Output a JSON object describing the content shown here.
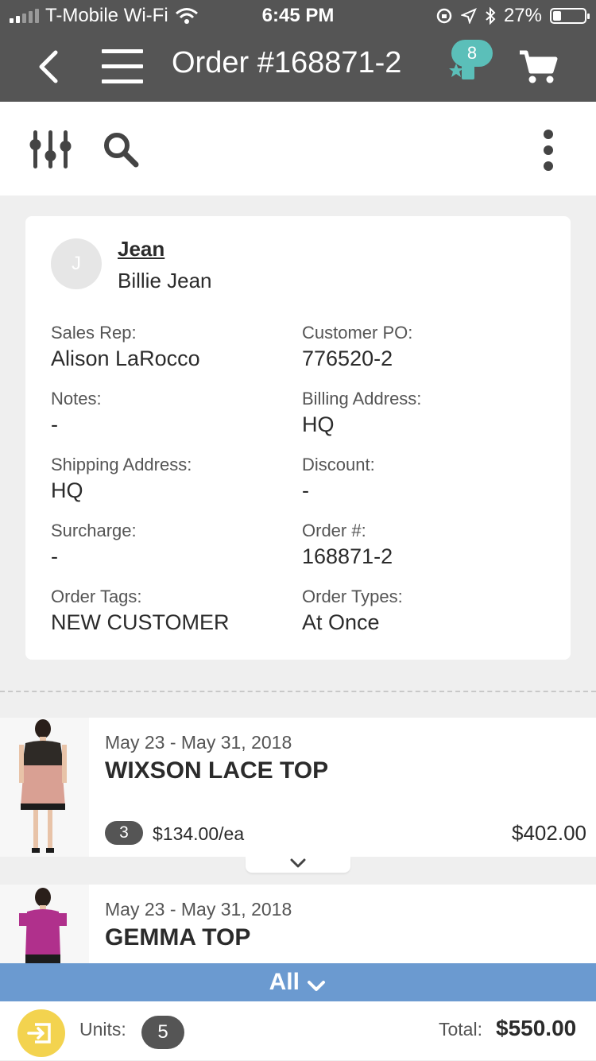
{
  "status_bar": {
    "carrier": "T-Mobile Wi-Fi",
    "time": "6:45 PM",
    "battery_percent": "27%",
    "battery_level": 0.27
  },
  "nav": {
    "title": "Order #168871-2",
    "badge_count": "8",
    "icons": [
      "back-icon",
      "menu-icon",
      "tag-star-icon",
      "cart-icon"
    ]
  },
  "toolbar": {
    "icons": [
      "filter-sliders-icon",
      "search-icon",
      "more-vertical-icon"
    ]
  },
  "customer": {
    "initial": "J",
    "name": "Jean",
    "contact": "Billie Jean"
  },
  "fields": {
    "sales_rep": {
      "label": "Sales Rep:",
      "value": "Alison LaRocco"
    },
    "customer_po": {
      "label": "Customer PO:",
      "value": "776520-2"
    },
    "notes": {
      "label": "Notes:",
      "value": "-"
    },
    "billing_address": {
      "label": "Billing Address:",
      "value": "HQ"
    },
    "shipping_address": {
      "label": "Shipping Address:",
      "value": "HQ"
    },
    "discount": {
      "label": "Discount:",
      "value": "-"
    },
    "surcharge": {
      "label": "Surcharge:",
      "value": "-"
    },
    "order_number": {
      "label": "Order #:",
      "value": "168871-2"
    },
    "order_tags": {
      "label": "Order Tags:",
      "value": "NEW CUSTOMER"
    },
    "order_types": {
      "label": "Order Types:",
      "value": "At Once"
    }
  },
  "items": [
    {
      "dates": "May 23 - May 31, 2018",
      "name": "WIXSON LACE TOP",
      "qty": "3",
      "unit_price": "$134.00/ea",
      "line_total": "$402.00"
    },
    {
      "dates": "May 23 - May 31, 2018",
      "name": "GEMMA TOP"
    }
  ],
  "filter_bar": {
    "label": "All"
  },
  "summary": {
    "units_label": "Units:",
    "units_value": "5",
    "total_label": "Total:",
    "total_value": "$550.00"
  },
  "colors": {
    "header": "#555555",
    "accent_teal": "#5bbfb9",
    "filter_blue": "#6b9ad0",
    "exit_yellow": "#f3d34f"
  }
}
